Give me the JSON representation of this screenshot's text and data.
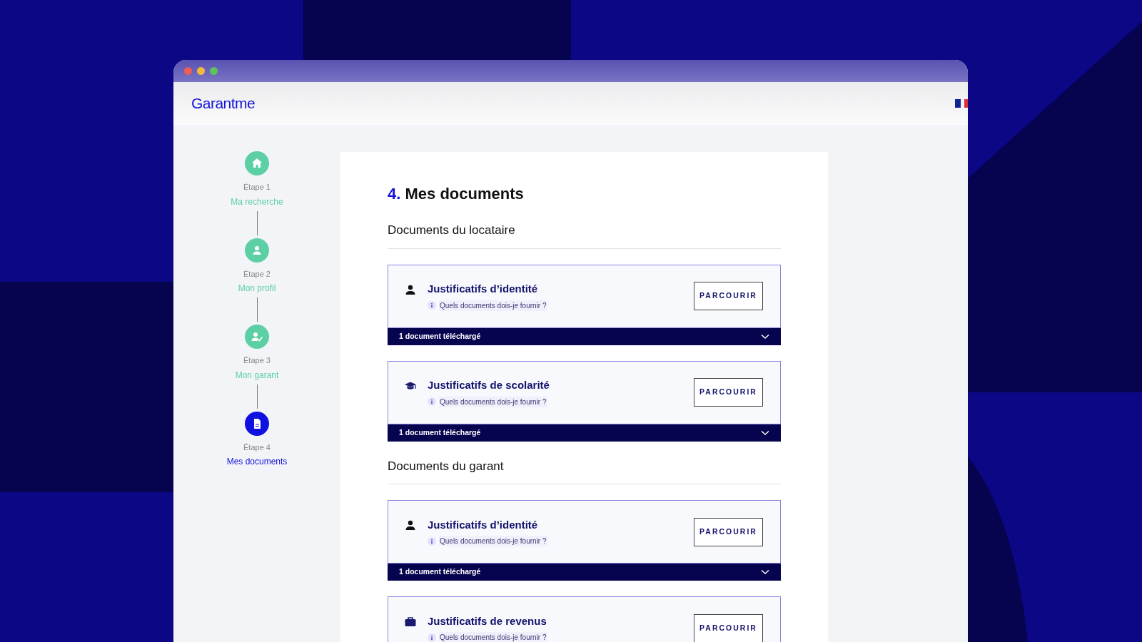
{
  "app": {
    "logo": "Garantme"
  },
  "steps": [
    {
      "label": "Étape 1",
      "name": "Ma recherche",
      "kind": "home",
      "current": false
    },
    {
      "label": "Étape 2",
      "name": "Mon profil",
      "kind": "person",
      "current": false
    },
    {
      "label": "Étape 3",
      "name": "Mon garant",
      "kind": "person-check",
      "current": false
    },
    {
      "label": "Étape 4",
      "name": "Mes documents",
      "kind": "document",
      "current": true
    }
  ],
  "page": {
    "number": "4.",
    "title": "Mes documents"
  },
  "sections": [
    {
      "title": "Documents du locataire",
      "documents": [
        {
          "kind": "person",
          "title": "Justificatifs d’identité",
          "hint": "Quels documents dois-je fournir ?",
          "button": "PARCOURIR",
          "status": "1 document téléchargé"
        },
        {
          "kind": "graduation",
          "title": "Justificatifs de scolarité",
          "hint": "Quels documents dois-je fournir ?",
          "button": "PARCOURIR",
          "status": "1 document téléchargé"
        }
      ]
    },
    {
      "title": "Documents du garant",
      "documents": [
        {
          "kind": "person",
          "title": "Justificatifs d’identité",
          "hint": "Quels documents dois-je fournir ?",
          "button": "PARCOURIR",
          "status": "1 document téléchargé"
        },
        {
          "kind": "briefcase",
          "title": "Justificatifs de revenus",
          "hint": "Quels documents dois-je fournir ?",
          "button": "PARCOURIR"
        }
      ]
    }
  ]
}
